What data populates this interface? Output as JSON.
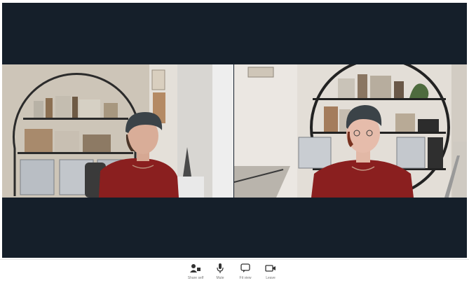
{
  "toolbar": {
    "buttons": [
      {
        "label": "Share self",
        "icon": "person-camera-icon"
      },
      {
        "label": "Mute",
        "icon": "microphone-icon"
      },
      {
        "label": "Fit view",
        "icon": "chat-icon"
      },
      {
        "label": "Leave",
        "icon": "video-camera-icon"
      }
    ]
  },
  "colors": {
    "background": "#151f2a",
    "shirt": "#8a1f1f",
    "hat": "#3b4348"
  }
}
